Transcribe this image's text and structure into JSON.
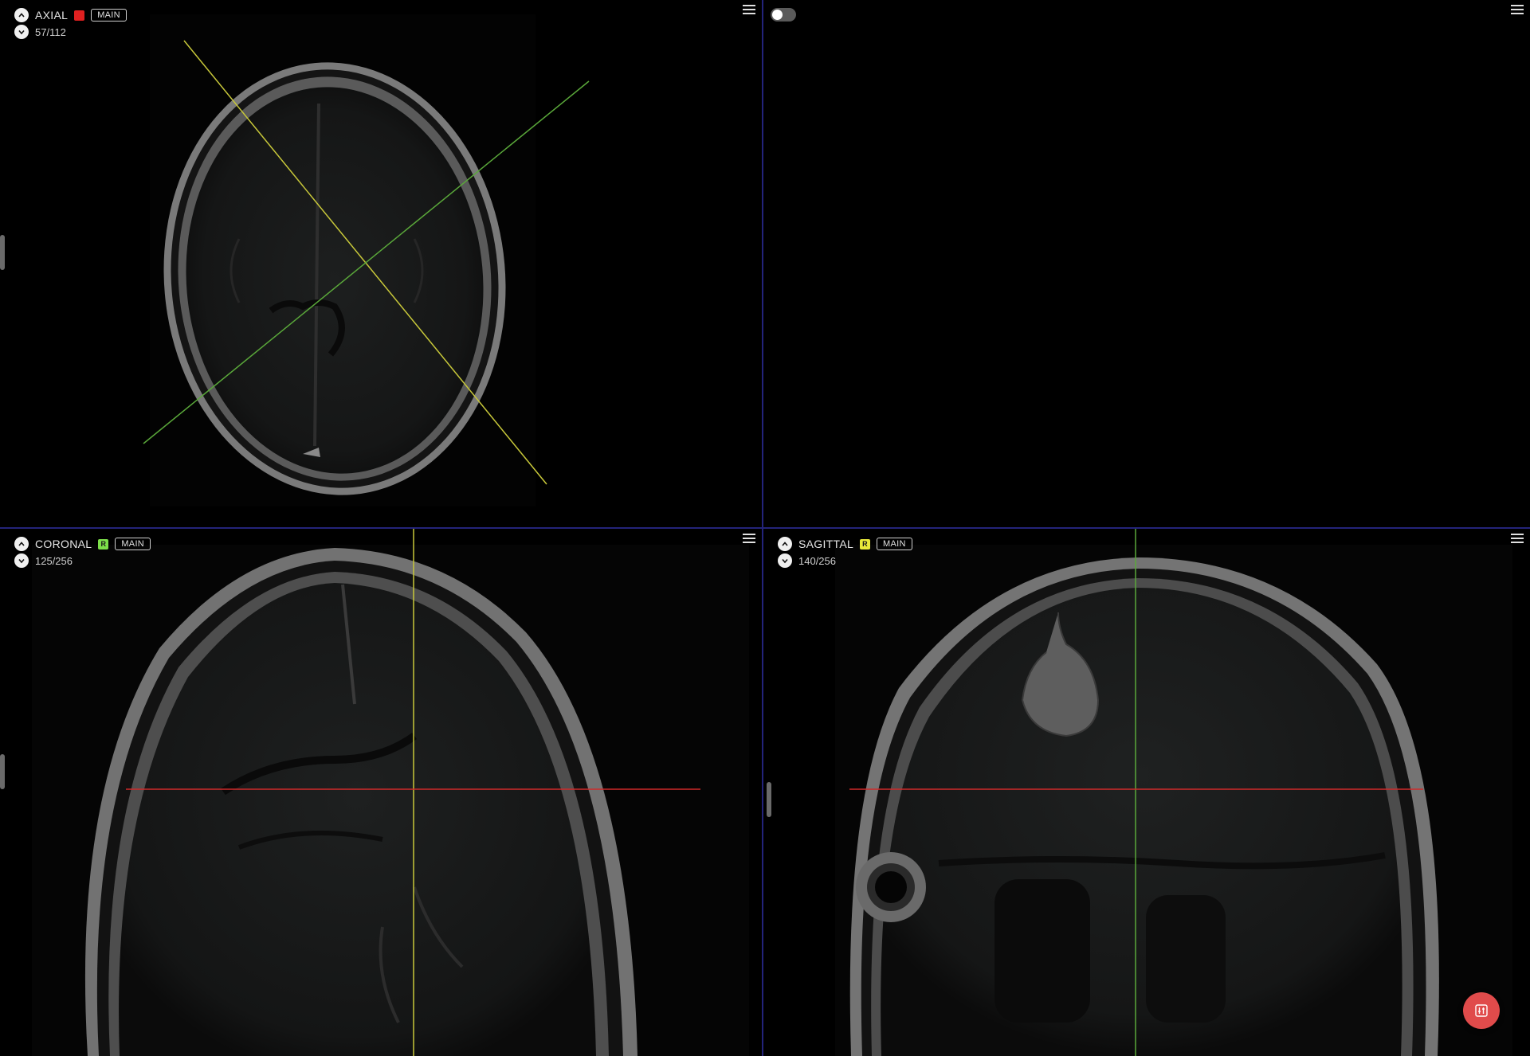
{
  "colors": {
    "background": "#000000",
    "divider": "#23237a",
    "axial_marker": "#e02020",
    "coronal_marker": "#7de04a",
    "sagittal_marker": "#e8e83a",
    "crosshair_yellow": "#c8c83a",
    "crosshair_green": "#5aa83a",
    "crosshair_red": "#d02a2a",
    "fab": "#e04b4b"
  },
  "viewports": {
    "axial": {
      "label": "AXIAL",
      "marker_text": "",
      "tag": "MAIN",
      "slice": "57/112"
    },
    "three_d": {
      "toggle_on": false
    },
    "coronal": {
      "label": "CORONAL",
      "marker_text": "R",
      "tag": "MAIN",
      "slice": "125/256"
    },
    "sagittal": {
      "label": "SAGITTAL",
      "marker_text": "R",
      "tag": "MAIN",
      "slice": "140/256"
    }
  },
  "icons": {
    "up": "chevron-up-icon",
    "down": "chevron-down-icon",
    "menu": "hamburger-menu-icon",
    "fab": "adjustments-icon"
  }
}
